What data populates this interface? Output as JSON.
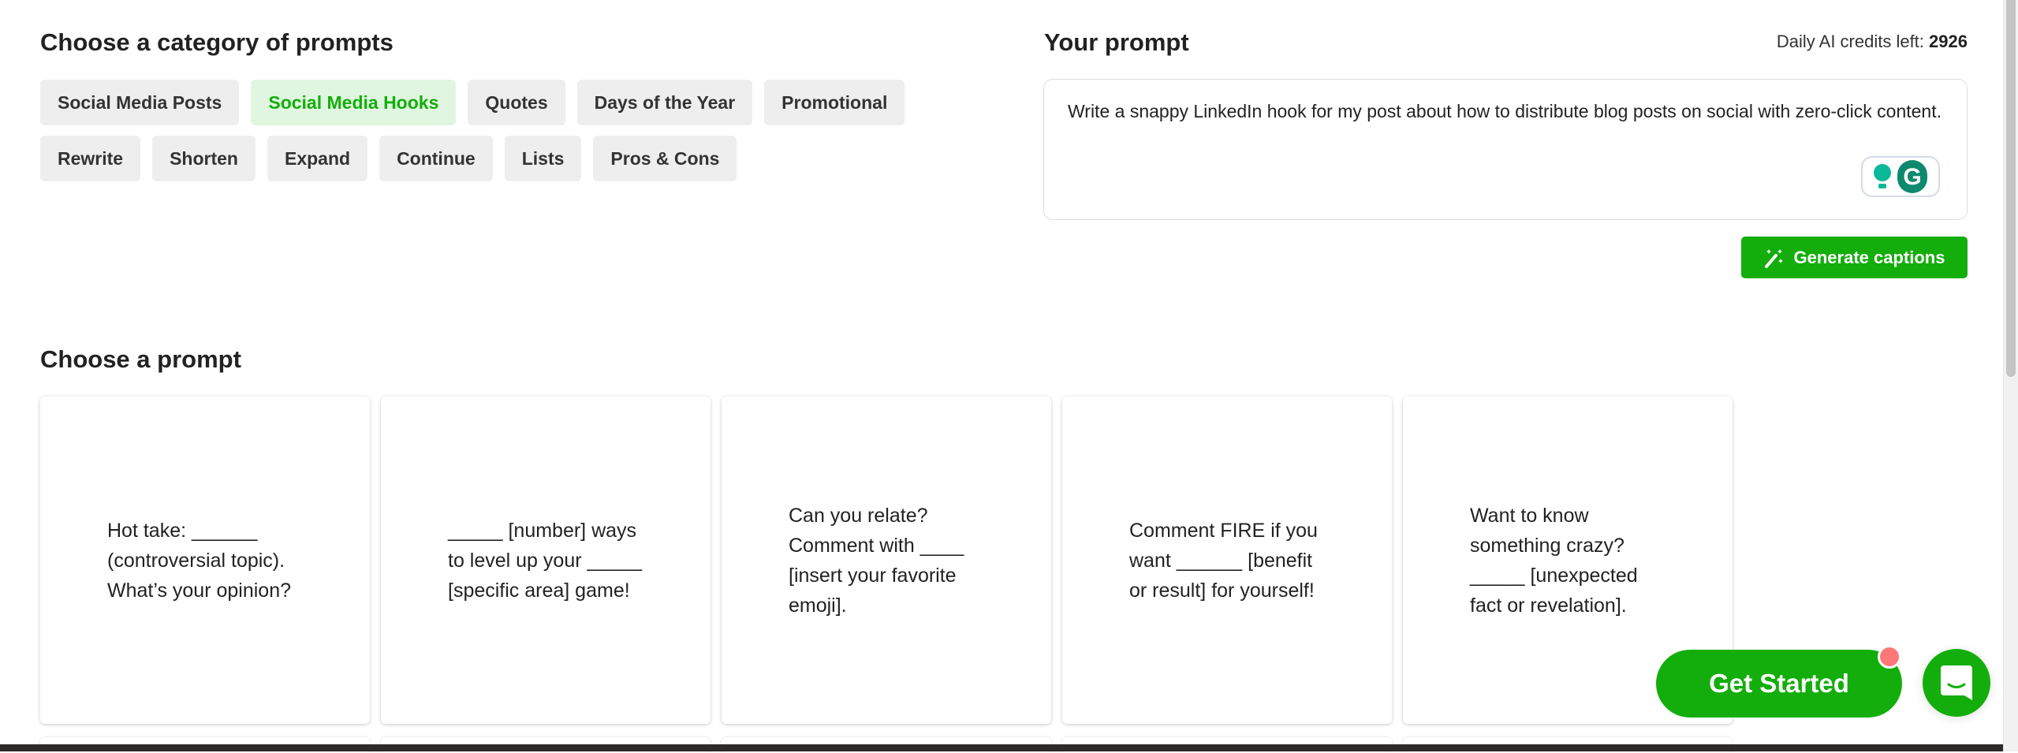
{
  "categories": {
    "title": "Choose a category of prompts",
    "row1": [
      "Social Media Posts",
      "Social Media Hooks",
      "Quotes",
      "Days of the Year",
      "Promotional"
    ],
    "row2": [
      "Rewrite",
      "Shorten",
      "Expand",
      "Continue",
      "Lists",
      "Pros & Cons"
    ],
    "active": "Social Media Hooks"
  },
  "prompt": {
    "title": "Your prompt",
    "credits_label": "Daily AI credits left:",
    "credits_value": "2926",
    "text": "Write a snappy LinkedIn hook for my post about how to distribute blog posts on social with zero-click content.",
    "grammarly_letter": "G",
    "generate_label": "Generate captions",
    "generate_icon": "magic-wand-icon"
  },
  "prompts": {
    "title": "Choose a prompt",
    "cards": [
      "Hot take: ______ (controversial topic). What’s your opinion?",
      "_____ [number] ways to level up your _____ [specific area] game!",
      "Can you relate? Comment with ____ [insert your favorite emoji].",
      "Comment FIRE if you want ______ [benefit or result] for yourself!",
      "Want to know something crazy? _____ [unexpected fact or revelation]."
    ]
  },
  "cta": {
    "get_started": "Get Started",
    "chat_icon": "chat-icon"
  },
  "colors": {
    "accent": "#13ae0b",
    "active_chip_bg": "#e0f6e0",
    "chip_bg": "#eeeeee",
    "notification": "#ff7777"
  }
}
